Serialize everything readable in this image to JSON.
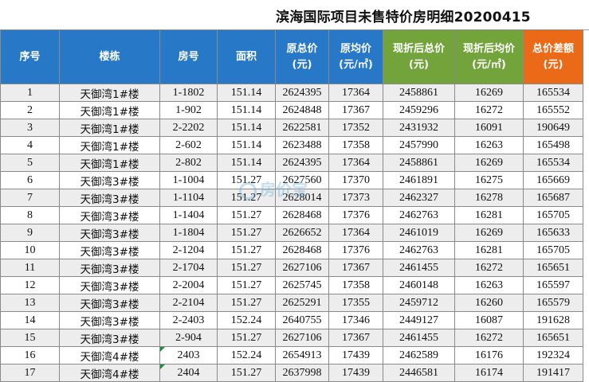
{
  "title": "滨海国际项目未售特价房明细20200415",
  "headers": [
    {
      "line1": "序号",
      "line2": "",
      "color": "blue"
    },
    {
      "line1": "楼栋",
      "line2": "",
      "color": "blue"
    },
    {
      "line1": "房号",
      "line2": "",
      "color": "blue"
    },
    {
      "line1": "面积",
      "line2": "",
      "color": "blue"
    },
    {
      "line1": "原总价",
      "line2": "(元)",
      "color": "blue"
    },
    {
      "line1": "原均价",
      "line2": "(元/㎡)",
      "color": "blue"
    },
    {
      "line1": "现折后总价",
      "line2": "(元)",
      "color": "green"
    },
    {
      "line1": "现折后均价",
      "line2": "(元/㎡)",
      "color": "green"
    },
    {
      "line1": "总价差额",
      "line2": "(元)",
      "color": "orange"
    }
  ],
  "rows": [
    [
      "1",
      "天御湾1#楼",
      "1-1802",
      "151.14",
      "2624395",
      "17364",
      "2458861",
      "16269",
      "165534"
    ],
    [
      "2",
      "天御湾1#楼",
      "1-902",
      "151.14",
      "2624848",
      "17367",
      "2459296",
      "16272",
      "165552"
    ],
    [
      "3",
      "天御湾1#楼",
      "2-2202",
      "151.14",
      "2622581",
      "17352",
      "2431932",
      "16091",
      "190649"
    ],
    [
      "4",
      "天御湾1#楼",
      "2-602",
      "151.14",
      "2623488",
      "17358",
      "2457990",
      "16263",
      "165498"
    ],
    [
      "5",
      "天御湾1#楼",
      "2-802",
      "151.14",
      "2624395",
      "17364",
      "2458861",
      "16269",
      "165534"
    ],
    [
      "6",
      "天御湾3#楼",
      "1-1004",
      "151.27",
      "2627560",
      "17370",
      "2461891",
      "16275",
      "165669"
    ],
    [
      "7",
      "天御湾3#楼",
      "1-1104",
      "151.27",
      "2628014",
      "17373",
      "2462327",
      "16278",
      "165687"
    ],
    [
      "8",
      "天御湾3#楼",
      "1-1404",
      "151.27",
      "2628468",
      "17376",
      "2462763",
      "16281",
      "165705"
    ],
    [
      "9",
      "天御湾3#楼",
      "1-1804",
      "151.27",
      "2626652",
      "17364",
      "2461019",
      "16269",
      "165633"
    ],
    [
      "10",
      "天御湾3#楼",
      "2-1204",
      "151.27",
      "2628468",
      "17376",
      "2462763",
      "16281",
      "165705"
    ],
    [
      "11",
      "天御湾3#楼",
      "2-1704",
      "151.27",
      "2627106",
      "17367",
      "2461455",
      "16272",
      "165651"
    ],
    [
      "12",
      "天御湾3#楼",
      "2-2004",
      "151.27",
      "2625745",
      "17358",
      "2460148",
      "16263",
      "165597"
    ],
    [
      "13",
      "天御湾3#楼",
      "2-2104",
      "151.27",
      "2625291",
      "17355",
      "2459712",
      "16260",
      "165579"
    ],
    [
      "14",
      "天御湾3#楼",
      "2-2403",
      "152.24",
      "2640755",
      "17346",
      "2449127",
      "16087",
      "191628"
    ],
    [
      "15",
      "天御湾3#楼",
      "2-904",
      "151.27",
      "2627106",
      "17367",
      "2461455",
      "16272",
      "165651"
    ],
    [
      "16",
      "天御湾4#楼",
      "2403",
      "152.24",
      "2654913",
      "17439",
      "2462589",
      "16176",
      "192324"
    ],
    [
      "17",
      "天御湾4#楼",
      "2404",
      "151.27",
      "2637998",
      "17439",
      "2446581",
      "16174",
      "191417"
    ]
  ],
  "flagged_rooms": [
    "2403",
    "2404"
  ],
  "watermark": "房价宝",
  "colors": {
    "header_blue": "#2878c8",
    "header_green": "#73a33b",
    "header_orange": "#ea6a18",
    "alt_row": "#ededed"
  }
}
